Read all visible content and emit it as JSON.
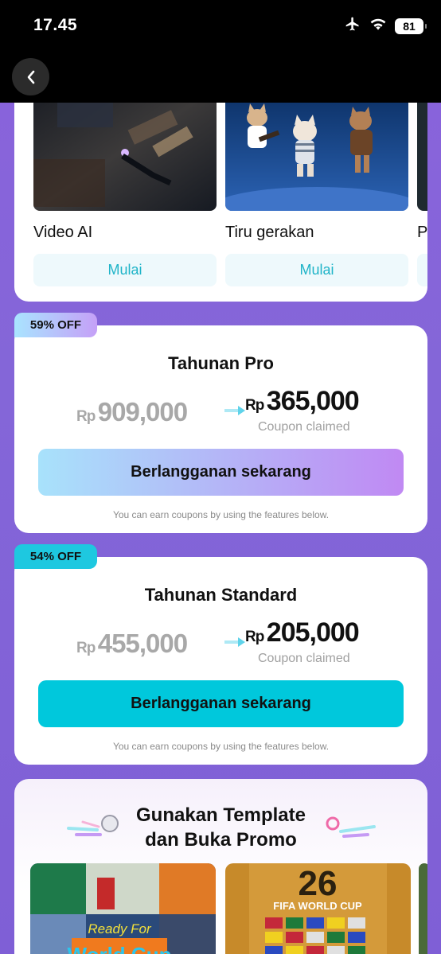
{
  "status_bar": {
    "time": "17.45",
    "battery": "81"
  },
  "features": [
    {
      "title": "Video AI",
      "button": "Mulai",
      "thumb": "ai-video-thumbnail"
    },
    {
      "title": "Tiru gerakan",
      "button": "Mulai",
      "thumb": "dancing-cats-thumbnail"
    },
    {
      "title": "P",
      "button": "",
      "thumb": "partial-thumbnail"
    }
  ],
  "plans": [
    {
      "badge": "59% OFF",
      "title": "Tahunan Pro",
      "currency": "Rp",
      "old_price": "909,000",
      "new_price": "365,000",
      "claimed": "Coupon claimed",
      "cta": "Berlangganan sekarang",
      "hint": "You can earn coupons by using the features below."
    },
    {
      "badge": "54% OFF",
      "title": "Tahunan Standard",
      "currency": "Rp",
      "old_price": "455,000",
      "new_price": "205,000",
      "claimed": "Coupon claimed",
      "cta": "Berlangganan sekarang",
      "hint": "You can earn coupons by using the features below."
    }
  ],
  "promo": {
    "title_line1": "Gunakan Template",
    "title_line2": "dan Buka Promo",
    "thumb_left_text1": "Ready For",
    "thumb_left_text2": "World Cup",
    "thumb_right_text": "FIFA WORLD CUP",
    "thumb_right_number": "26"
  },
  "colors": {
    "background": "#8466d8",
    "accent_teal": "#00c8dc",
    "pro_badge_start": "#a9e4ff",
    "pro_badge_end": "#c084f5",
    "standard_badge": "#1ec8e0"
  }
}
